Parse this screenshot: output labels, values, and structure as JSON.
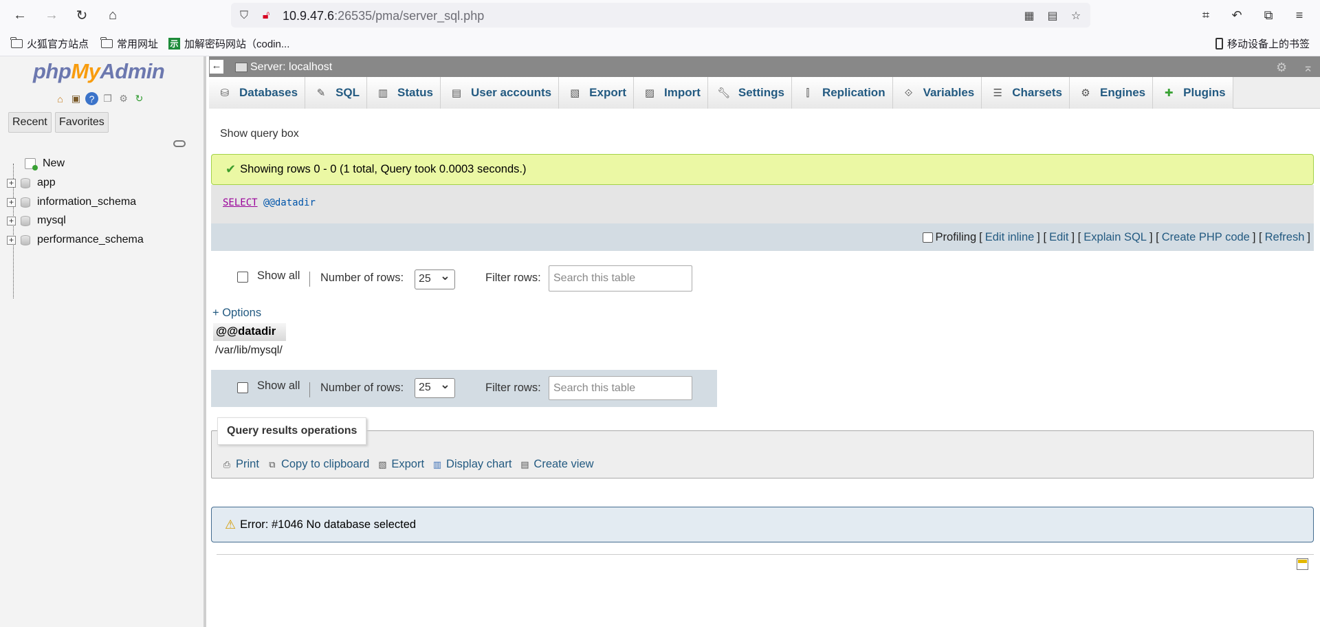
{
  "browser": {
    "url_host": "10.9.47.6",
    "url_rest": ":26535/pma/server_sql.php",
    "bookmarks": [
      "火狐官方站点",
      "常用网址",
      "加解密码网站（codin...",
      "移动设备上的书签"
    ]
  },
  "nav": {
    "logo_php": "php",
    "logo_my": "My",
    "logo_admin": "Admin",
    "recent": "Recent",
    "favorites": "Favorites",
    "tree": [
      "New",
      "app",
      "information_schema",
      "mysql",
      "performance_schema"
    ]
  },
  "serverbar": {
    "label": "Server: localhost",
    "collapse": "←"
  },
  "tabs": [
    "Databases",
    "SQL",
    "Status",
    "User accounts",
    "Export",
    "Import",
    "Settings",
    "Replication",
    "Variables",
    "Charsets",
    "Engines",
    "Plugins"
  ],
  "main": {
    "show_query_box": "Show query box",
    "success_msg": "Showing rows 0 - 0 (1 total, Query took 0.0003 seconds.)",
    "sql_keyword": "SELECT",
    "sql_var": "@@datadir",
    "profiling": "Profiling",
    "links": [
      "Edit inline",
      "Edit",
      "Explain SQL",
      "Create PHP code",
      "Refresh"
    ],
    "show_all": "Show all",
    "number_of_rows": "Number of rows:",
    "rows_value": "25",
    "filter_rows": "Filter rows:",
    "search_placeholder": "Search this table",
    "options": "+ Options",
    "column": "@@datadir",
    "value": "/var/lib/mysql/",
    "qro_title": "Query results operations",
    "qro_links": [
      "Print",
      "Copy to clipboard",
      "Export",
      "Display chart",
      "Create view"
    ],
    "error_msg": "Error: #1046 No database selected"
  },
  "colors": {
    "link": "#235a81",
    "success_bg": "#ebf8a4",
    "serverbar": "#888888",
    "error_bg": "#e3ebf2"
  }
}
